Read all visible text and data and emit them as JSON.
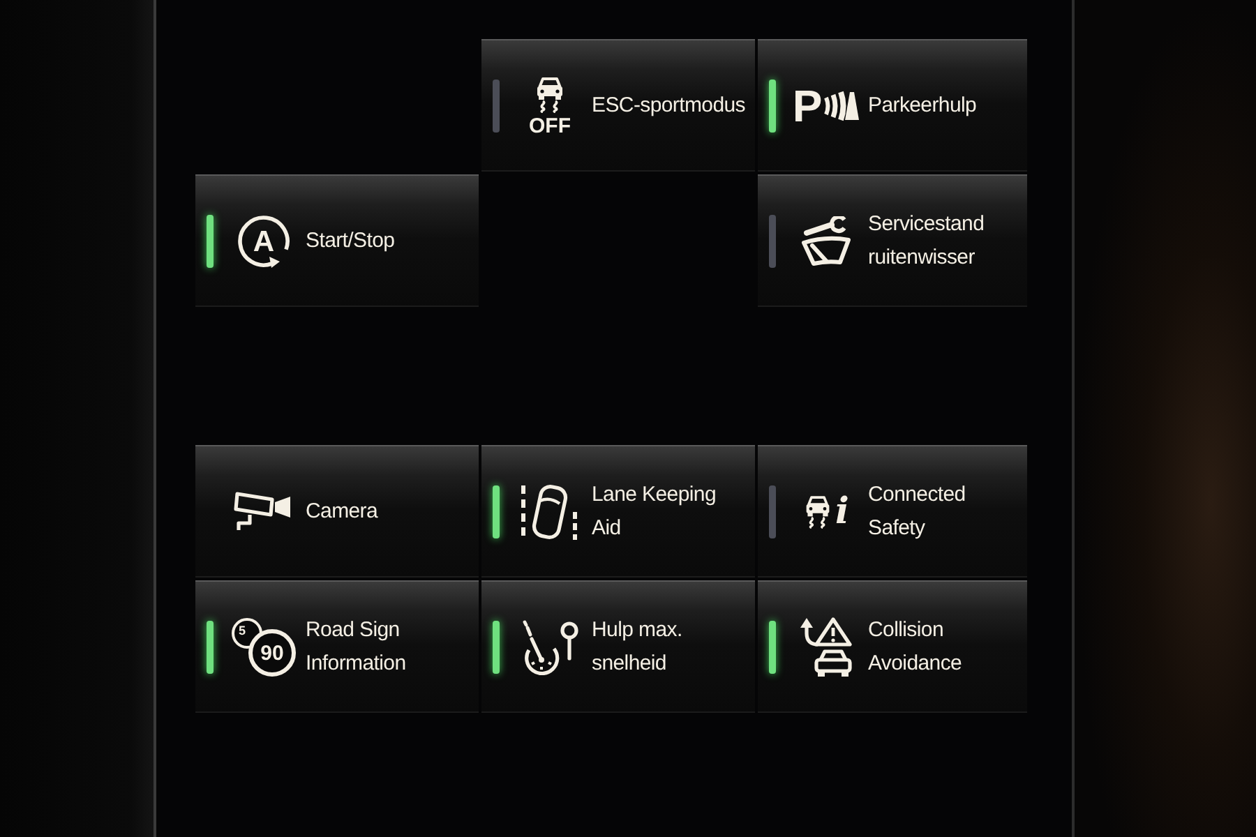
{
  "rows": [
    {
      "cells": [
        {
          "kind": "empty"
        },
        {
          "kind": "toggle",
          "on": false,
          "icon_labels": [
            "OFF"
          ],
          "label_lines": [
            "ESC-sportmodus"
          ]
        },
        {
          "kind": "toggle",
          "on": true,
          "icon_labels": [
            "P"
          ],
          "label_lines": [
            "Parkeerhulp"
          ]
        }
      ]
    },
    {
      "cells": [
        {
          "kind": "toggle",
          "on": true,
          "icon_labels": [
            "A"
          ],
          "label_lines": [
            "Start/Stop"
          ]
        },
        {
          "kind": "empty"
        },
        {
          "kind": "toggle",
          "on": false,
          "label_lines": [
            "Servicestand",
            "ruitenwisser"
          ]
        }
      ]
    },
    {
      "cells": [
        {
          "kind": "empty"
        },
        {
          "kind": "empty"
        },
        {
          "kind": "empty"
        }
      ]
    },
    {
      "cells": [
        {
          "kind": "action",
          "label_lines": [
            "Camera"
          ]
        },
        {
          "kind": "toggle",
          "on": true,
          "label_lines": [
            "Lane Keeping",
            "Aid"
          ]
        },
        {
          "kind": "toggle",
          "on": false,
          "icon_labels": [
            "i"
          ],
          "label_lines": [
            "Connected",
            "Safety"
          ]
        }
      ]
    },
    {
      "cells": [
        {
          "kind": "toggle",
          "on": true,
          "icon_labels": [
            "5",
            "90"
          ],
          "label_lines": [
            "Road Sign",
            "Information"
          ]
        },
        {
          "kind": "toggle",
          "on": true,
          "label_lines": [
            "Hulp max.",
            "snelheid"
          ]
        },
        {
          "kind": "toggle",
          "on": true,
          "label_lines": [
            "Collision",
            "Avoidance"
          ]
        }
      ]
    }
  ]
}
